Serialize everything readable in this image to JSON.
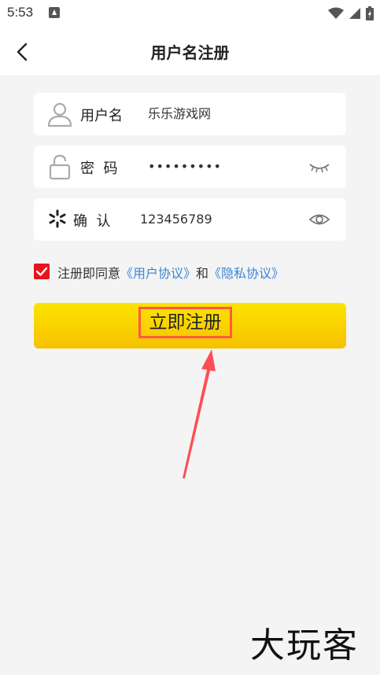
{
  "status_bar": {
    "time": "5:53"
  },
  "header": {
    "title": "用户名注册"
  },
  "form": {
    "username": {
      "label": "用户名",
      "value": "乐乐游戏网"
    },
    "password": {
      "label": "密  码",
      "value": "•••••••••"
    },
    "confirm": {
      "label": "确  认",
      "value": "123456789"
    }
  },
  "agreement": {
    "checked": true,
    "prefix": "注册即同意",
    "user_agreement": "《用户协议》",
    "conjunction": "和",
    "privacy_policy": "《隐私协议》"
  },
  "register_button": {
    "label": "立即注册"
  },
  "watermark": "大玩客",
  "colors": {
    "accent_yellow": "#fbd800",
    "checkbox_red": "#e8141b",
    "link_blue": "#3a86d8",
    "highlight_box": "#ff5745"
  }
}
